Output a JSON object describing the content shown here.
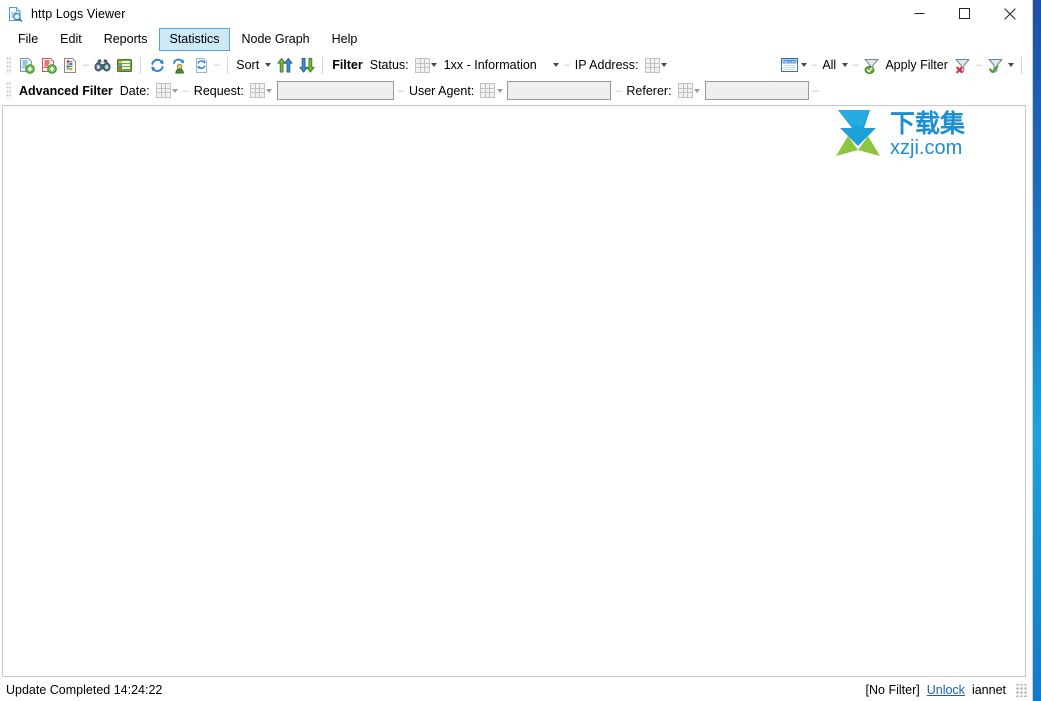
{
  "window": {
    "title": "http Logs Viewer",
    "icon": "document-search-icon",
    "controls": {
      "minimize": "minimize-button",
      "maximize": "maximize-button",
      "close": "close-button"
    }
  },
  "menubar": {
    "items": [
      {
        "label": "File",
        "active": false
      },
      {
        "label": "Edit",
        "active": false
      },
      {
        "label": "Reports",
        "active": false
      },
      {
        "label": "Statistics",
        "active": true
      },
      {
        "label": "Node Graph",
        "active": false
      },
      {
        "label": "Help",
        "active": false
      }
    ]
  },
  "toolbar_main": {
    "icons": [
      {
        "name": "open-log-icon",
        "title": "Open Log File"
      },
      {
        "name": "open-log-red-icon",
        "title": "Open Error Log"
      },
      {
        "name": "log-properties-icon",
        "title": "Log Properties"
      },
      {
        "name": "binoculars-icon",
        "title": "Find"
      },
      {
        "name": "log-list-icon",
        "title": "Log List"
      },
      {
        "name": "refresh-icon",
        "title": "Refresh"
      },
      {
        "name": "refresh-user-icon",
        "title": "Refresh Users"
      },
      {
        "name": "reload-page-icon",
        "title": "Reload Page"
      }
    ],
    "sort_label": "Sort",
    "sort_ascending_icon": "sort-ascending-icon",
    "sort_descending_icon": "sort-descending-icon",
    "filter_label": "Filter",
    "status_label": "Status:",
    "status_grid_icon": "status-grid-icon",
    "status_value": "1xx - Information",
    "ip_label": "IP Address:",
    "ip_grid_icon": "ip-grid-icon",
    "date_range_icon": "date-range-icon",
    "all_label": "All",
    "apply_filter_icon": "funnel-green-icon",
    "apply_filter_label": "Apply Filter",
    "clear_filter_icon": "funnel-clear-icon",
    "saved_filter_icon": "funnel-check-icon"
  },
  "toolbar_advanced": {
    "title": "Advanced Filter",
    "fields": [
      {
        "label": "Date:",
        "grid_icon": "date-grid-icon",
        "value": "",
        "has_textbox": false
      },
      {
        "label": "Request:",
        "grid_icon": "request-grid-icon",
        "value": "",
        "has_textbox": true
      },
      {
        "label": "User Agent:",
        "grid_icon": "useragent-grid-icon",
        "value": "",
        "has_textbox": true
      },
      {
        "label": "Referer:",
        "grid_icon": "referer-grid-icon",
        "value": "",
        "has_textbox": true
      }
    ]
  },
  "content": {
    "watermark": {
      "name": "xzji-watermark",
      "cn_text": "下载集",
      "domain_text": "xzji.com"
    }
  },
  "statusbar": {
    "message": "Update Completed 14:24:22",
    "filter_state": "[No Filter]",
    "unlock_label": "Unlock",
    "user": "iannet",
    "grip": "resize-grip"
  },
  "colors": {
    "accent_blue": "#1a5fb4",
    "menu_highlight_bg": "#cde8f7",
    "menu_highlight_border": "#5ba6d6",
    "desktop_blue": "#1878c8",
    "watermark_blue": "#1f9fd8",
    "watermark_green": "#7dc242"
  }
}
